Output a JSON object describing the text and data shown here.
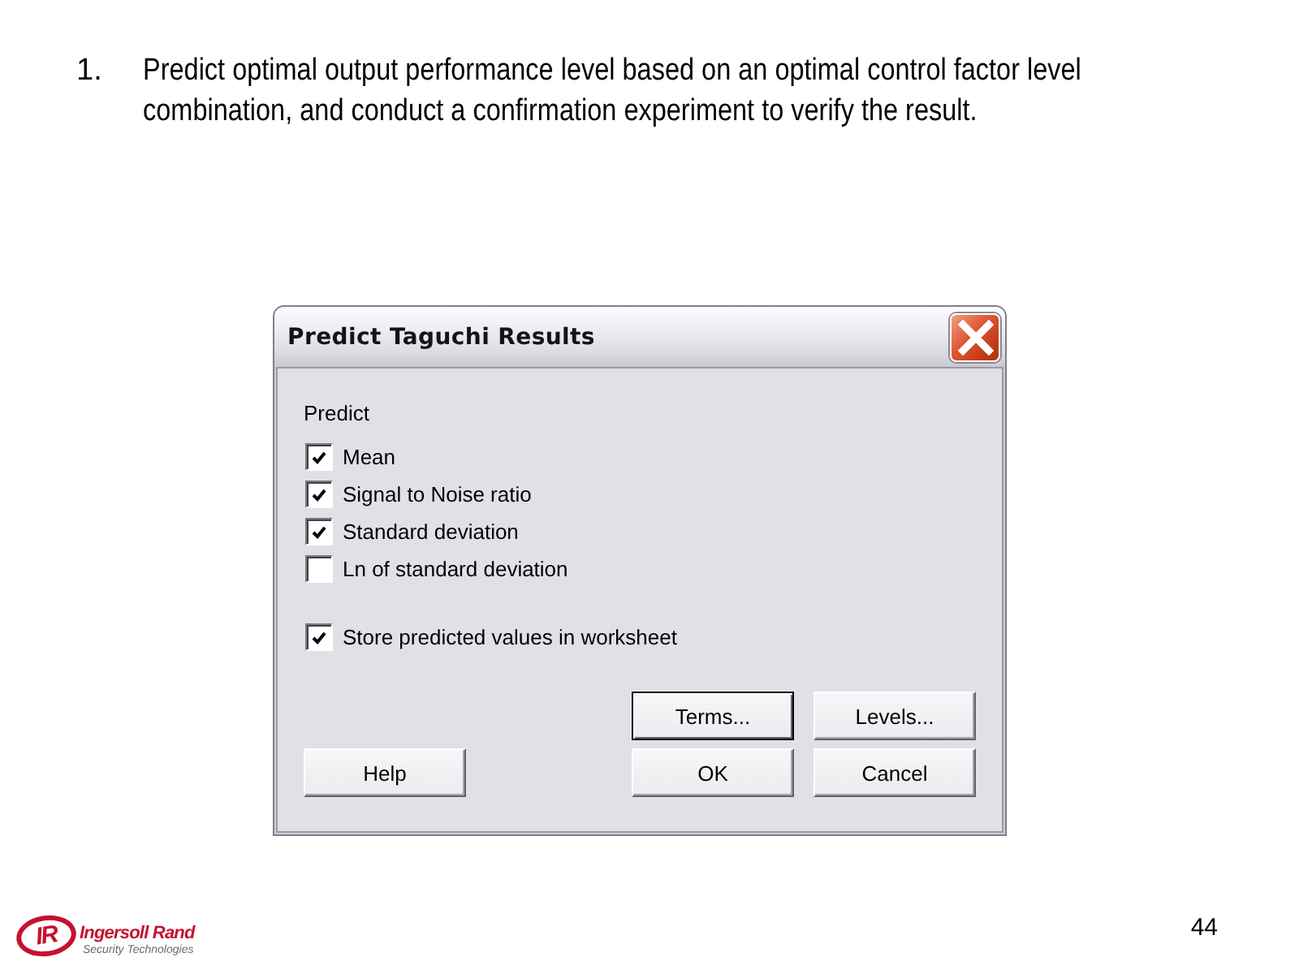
{
  "list": [
    {
      "number": "1.",
      "text": "Predict optimal output performance level based on an optimal control factor level combination, and conduct a confirmation experiment to verify the result."
    }
  ],
  "dialog": {
    "title": "Predict Taguchi Results",
    "group_label": "Predict",
    "options": [
      {
        "label": "Mean",
        "checked": true
      },
      {
        "label": "Signal to Noise ratio",
        "checked": true
      },
      {
        "label": "Standard deviation",
        "checked": true
      },
      {
        "label": "Ln of standard deviation",
        "checked": false
      }
    ],
    "store_option": {
      "label": "Store predicted values in worksheet",
      "checked": true
    },
    "button_rows": [
      [
        {
          "label": "Terms...",
          "focused": true
        },
        {
          "label": "Levels...",
          "focused": false
        }
      ],
      [
        {
          "label": "Help",
          "focused": false
        },
        {
          "label": "OK",
          "focused": false
        },
        {
          "label": "Cancel",
          "focused": false
        }
      ]
    ]
  },
  "footer": {
    "logo": {
      "mark": "IR",
      "name": "Ingersoll Rand",
      "tagline": "Security Technologies"
    },
    "page_number": "44"
  }
}
